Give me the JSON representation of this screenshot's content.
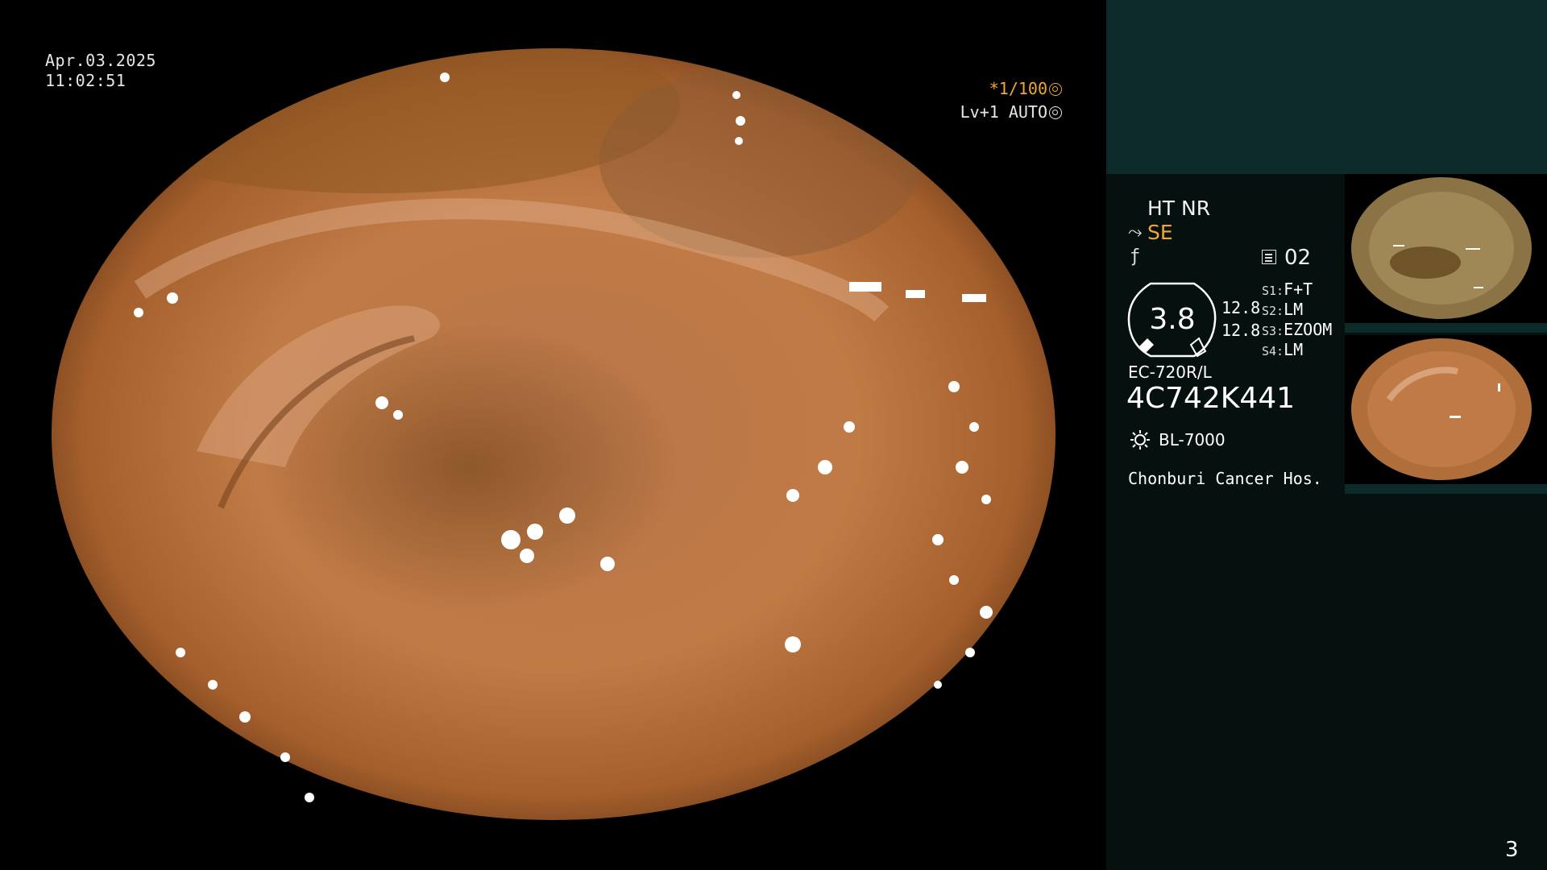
{
  "overlay": {
    "date": "Apr.03.2025",
    "time": "11:02:51",
    "shutter": "*1/100",
    "level": "Lv+1 AUTO"
  },
  "panel": {
    "mode_line1": "HT NR",
    "mode_se": "SE",
    "memory_value": "02",
    "gauge_value": "3.8",
    "gauge_side_a": "12.8",
    "gauge_side_b": "12.8",
    "switches": [
      {
        "key": "S1:",
        "value": "F+T"
      },
      {
        "key": "S2:",
        "value": "LM"
      },
      {
        "key": "S3:",
        "value": "EZOOM"
      },
      {
        "key": "S4:",
        "value": "LM"
      }
    ],
    "scope_model": "EC-720R/L",
    "scope_serial": "4C742K441",
    "light_source": "BL-7000",
    "hospital": "Chonburi Cancer Hos.",
    "page_number": "3"
  },
  "icons": [
    "shutter-icon",
    "auto-iris-icon",
    "se-scope-icon",
    "freeze-icon",
    "memory-icon",
    "light-source-icon"
  ],
  "colors": {
    "accent_orange": "#f0a830",
    "panel_teal": "#0c2a2a",
    "panel_dark": "#06100f"
  }
}
